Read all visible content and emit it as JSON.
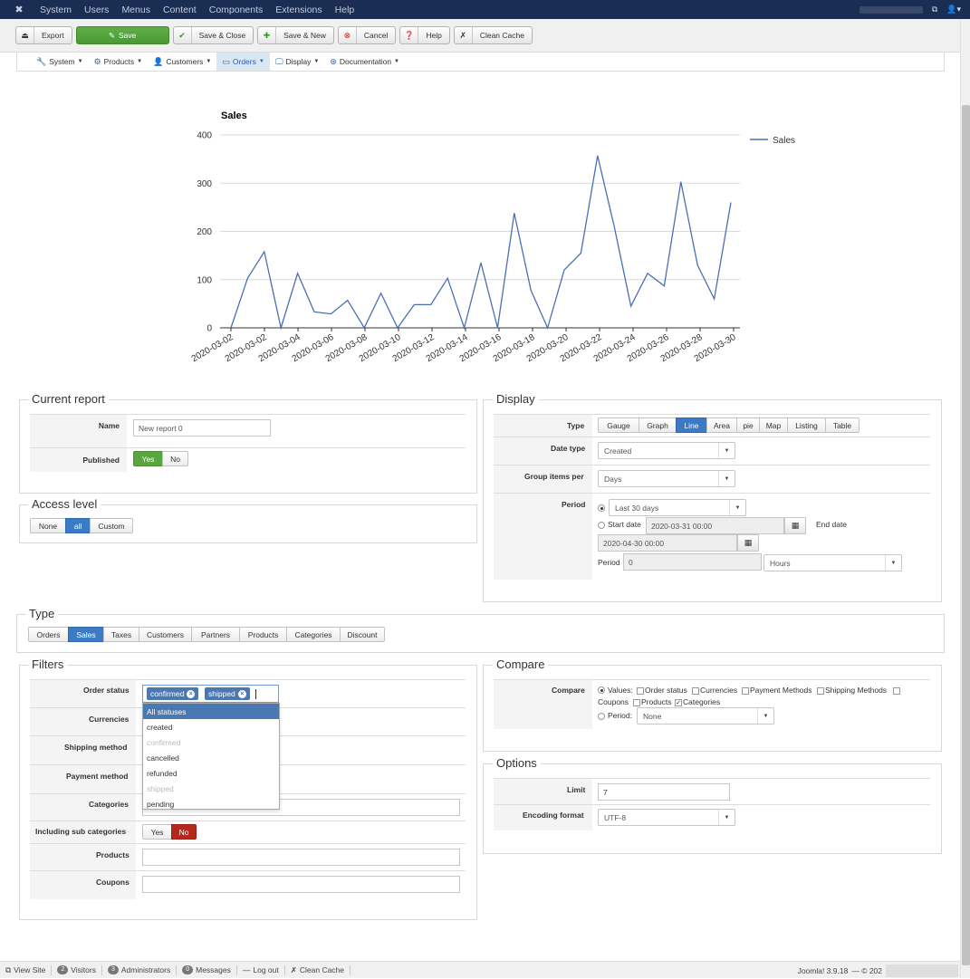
{
  "topmenu": {
    "logo": "joomla-logo",
    "items": [
      "System",
      "Users",
      "Menus",
      "Content",
      "Components",
      "Extensions",
      "Help"
    ]
  },
  "toolbar": {
    "export": "Export",
    "save": "Save",
    "save_close": "Save & Close",
    "save_new": "Save & New",
    "cancel": "Cancel",
    "help": "Help",
    "clean_cache": "Clean Cache"
  },
  "subnav": {
    "items": [
      "System",
      "Products",
      "Customers",
      "Orders",
      "Display",
      "Documentation"
    ],
    "active": "Orders"
  },
  "chart_data": {
    "type": "line",
    "title": "Sales",
    "legend": [
      "Sales"
    ],
    "legend_position": "top-right",
    "xlabel": "",
    "ylabel": "",
    "ylim": [
      0,
      400
    ],
    "yticks": [
      0,
      100,
      200,
      300,
      400
    ],
    "grid": true,
    "color": "#4a6fb5",
    "xtick_labels": [
      "2020-03-02",
      "2020-03-02",
      "2020-03-04",
      "2020-03-06",
      "2020-03-08",
      "2020-03-10",
      "2020-03-12",
      "2020-03-14",
      "2020-03-16",
      "2020-03-18",
      "2020-03-20",
      "2020-03-22",
      "2020-03-24",
      "2020-03-26",
      "2020-03-28",
      "2020-03-30"
    ],
    "series": [
      {
        "name": "Sales",
        "values": [
          0,
          103,
          158,
          0,
          113,
          33,
          29,
          57,
          0,
          72,
          0,
          48,
          48,
          103,
          0,
          135,
          0,
          238,
          78,
          0,
          120,
          155,
          357,
          210,
          45,
          113,
          87,
          303,
          130,
          60,
          260
        ]
      }
    ]
  },
  "current_report": {
    "legend": "Current report",
    "name_label": "Name",
    "name_value": "New report 0",
    "published_label": "Published",
    "yes": "Yes",
    "no": "No"
  },
  "access_level": {
    "legend": "Access level",
    "options": [
      "None",
      "all",
      "Custom"
    ],
    "selected": "all"
  },
  "display": {
    "legend": "Display",
    "type_label": "Type",
    "types": [
      "Gauge",
      "Graph",
      "Line",
      "Area",
      "pie",
      "Map",
      "Listing",
      "Table"
    ],
    "selected_type": "Line",
    "date_type_label": "Date type",
    "date_type_value": "Created",
    "group_label": "Group items per",
    "group_value": "Days",
    "period_label": "Period",
    "period_value": "Last 30 days",
    "start_date_label": "Start date",
    "start_date_value": "2020-03-31 00:00",
    "end_date_label": "End date",
    "end_date_value": "2020-04-30 00:00",
    "period2_label": "Period",
    "period2_value": "0",
    "period2_unit": "Hours"
  },
  "type_section": {
    "legend": "Type",
    "tabs": [
      "Orders",
      "Sales",
      "Taxes",
      "Customers",
      "Partners",
      "Products",
      "Categories",
      "Discount"
    ],
    "selected": "Sales"
  },
  "filters": {
    "legend": "Filters",
    "order_status_label": "Order status",
    "chips": [
      "confirmed",
      "shipped"
    ],
    "chip_remove": "×",
    "dropdown_options": [
      {
        "label": "All statuses",
        "state": "highlighted"
      },
      {
        "label": "created",
        "state": "normal"
      },
      {
        "label": "confirmed",
        "state": "disabled"
      },
      {
        "label": "cancelled",
        "state": "normal"
      },
      {
        "label": "refunded",
        "state": "normal"
      },
      {
        "label": "shipped",
        "state": "disabled"
      },
      {
        "label": "pending",
        "state": "normal"
      }
    ],
    "currencies_label": "Currencies",
    "shipping_label": "Shipping method",
    "payment_label": "Payment method",
    "categories_label": "Categories",
    "subcat_label": "Including sub categories",
    "subcat_yes": "Yes",
    "subcat_no": "No",
    "products_label": "Products",
    "coupons_label": "Coupons"
  },
  "compare": {
    "legend": "Compare",
    "label": "Compare",
    "values_label": "Values:",
    "checkboxes": [
      {
        "label": "Order status",
        "checked": false
      },
      {
        "label": "Currencies",
        "checked": false
      },
      {
        "label": "Payment Methods",
        "checked": false
      },
      {
        "label": "Shipping Methods",
        "checked": false
      },
      {
        "label": "Coupons",
        "checked": false
      },
      {
        "label": "Products",
        "checked": false
      },
      {
        "label": "Categories",
        "checked": true
      }
    ],
    "period_label": "Period:",
    "period_value": "None"
  },
  "options": {
    "legend": "Options",
    "limit_label": "Limit",
    "limit_value": "7",
    "encoding_label": "Encoding format",
    "encoding_value": "UTF-8"
  },
  "statusbar": {
    "view_site": "View Site",
    "visitors_count": "2",
    "visitors": "Visitors",
    "admins_count": "3",
    "admins": "Administrators",
    "messages_count": "0",
    "messages": "Messages",
    "logout": "Log out",
    "clean_cache": "Clean Cache",
    "version": "Joomla! 3.9.18",
    "copyright": "— © 202"
  }
}
